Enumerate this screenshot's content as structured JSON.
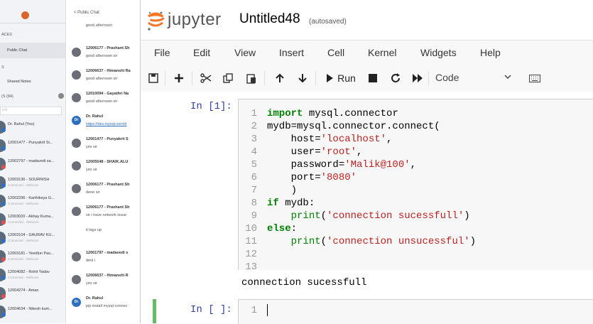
{
  "chat": {
    "sidebar": {
      "section_spaces": "ACES",
      "public_chat": "Public Chat",
      "section_s": "S",
      "shared_notes": "Shared Notes",
      "users_header": "(S (84)",
      "search_placeholder": "rch",
      "contacts": [
        {
          "name": "Dr. Rahul (You)",
          "status": "",
          "color": "#2d6fc0"
        },
        {
          "name": "12001477 - Punyakrit Si...",
          "status": "",
          "color": "#2d6fc0"
        },
        {
          "name": "12002797 - madavedi sa...",
          "status": "",
          "color": "#e05050"
        },
        {
          "name": "12003136 - SOURNISH",
          "status": "Connected · Webcam",
          "color": "#2d6fc0"
        },
        {
          "name": "12002296 - Karthikeya G...",
          "status": "Connected · Webcam",
          "color": "#2d6fc0"
        },
        {
          "name": "12003020 - Akhay Kuma...",
          "status": "Connected · Webcam",
          "color": "#e05050"
        },
        {
          "name": "12003104 - GAURAV KU...",
          "status": "Connected · Webcam",
          "color": "#2d6fc0"
        },
        {
          "name": "12003181 - Yeedlun Pau...",
          "status": "Connected · Webcam",
          "color": "#e05050"
        },
        {
          "name": "12004082 - Rohit Yadav",
          "status": "Connected · Webcam",
          "color": "#2d6fc0"
        },
        {
          "name": "12004274 - Aman",
          "status": "",
          "color": "#e05050"
        },
        {
          "name": "12004634 - Nikesh kum...",
          "status": "",
          "color": "#2d6fc0"
        }
      ]
    },
    "panel": {
      "title": "< Public Chat",
      "messages": [
        {
          "name": "",
          "text": "good afternoon",
          "avatar": ""
        },
        {
          "name": "12006177 - Prashant Sh",
          "text": "good afternoon sir",
          "avatar": ""
        },
        {
          "name": "12006637 - Himanshi Ra",
          "text": "good afternoon sir",
          "avatar": ""
        },
        {
          "name": "12010094 - Gayathri Na",
          "text": "good afternoon sir",
          "avatar": ""
        },
        {
          "name": "Dr. Rahul",
          "text": "https://dev.mysql.com/d",
          "avatar": "Dr",
          "link": true
        },
        {
          "name": "12001477 - Punyakrit S",
          "text": "yes sir",
          "avatar": ""
        },
        {
          "name": "12005548 - SHAIK.ALU",
          "text": "yes sir",
          "avatar": ""
        },
        {
          "name": "12006177 - Prashant Sh",
          "text": "done sir",
          "avatar": ""
        },
        {
          "name": "12006177 - Prashant Sh",
          "text": "sir i have network issue",
          "avatar": ""
        },
        {
          "name": "",
          "text": "it lags up",
          "avatar": ""
        },
        {
          "name": "12001797 - madavedi s",
          "text": "dmil i",
          "avatar": ""
        },
        {
          "name": "12006637 - Himanshi R",
          "text": "yes sir",
          "avatar": ""
        },
        {
          "name": "Dr. Rahul",
          "text": "pip install mysql-connec",
          "avatar": "Dr"
        }
      ]
    }
  },
  "jupyter": {
    "logo_text": "jupyter",
    "notebook_name": "Untitled48",
    "save_status": "(autosaved)",
    "menu": [
      "File",
      "Edit",
      "View",
      "Insert",
      "Cell",
      "Kernel",
      "Widgets",
      "Help"
    ],
    "toolbar": {
      "run_label": "Run",
      "cell_type": "Code"
    },
    "cell1": {
      "prompt": "In [1]:",
      "line_numbers": [
        "1",
        "2",
        "3",
        "4",
        "5",
        "6",
        "7",
        "8",
        "9",
        "10",
        "11",
        "12",
        "13"
      ],
      "output": "connection sucessfull"
    },
    "cell2": {
      "prompt": "In [ ]:",
      "line_number": "1"
    }
  },
  "colors": {
    "prompt_blue": "#303f9f",
    "keyword_green": "#008000",
    "string_red": "#ba2121",
    "active_cell_border": "#66bb6a",
    "jupyter_orange": "#f37726"
  }
}
